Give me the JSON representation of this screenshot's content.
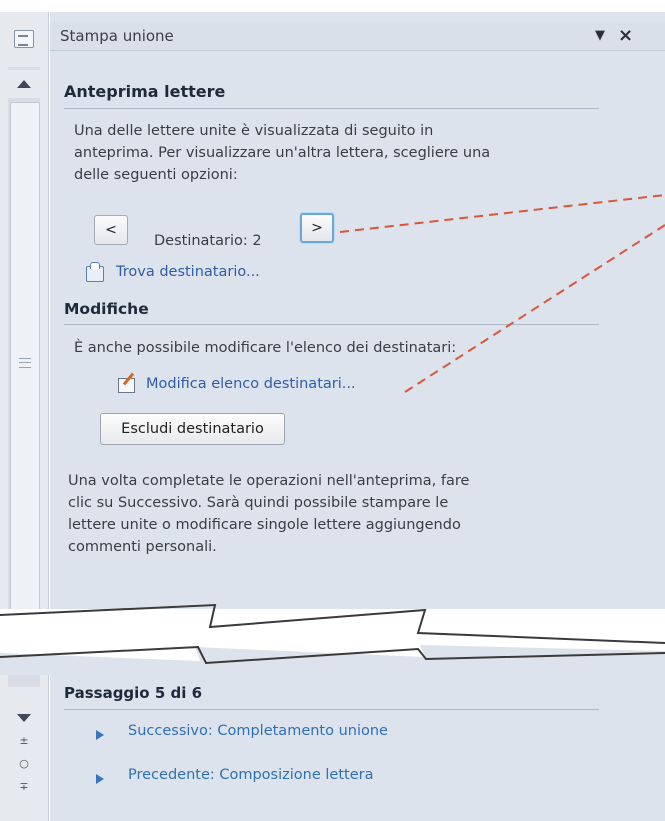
{
  "pane": {
    "title": "Stampa unione",
    "menu_icon": "dropdown-triangle",
    "close_label": "×"
  },
  "preview": {
    "heading": "Anteprima lettere",
    "line1": "Una delle lettere unite è visualizzata di seguito in",
    "line2": "anteprima. Per visualizzare un'altra lettera, scegliere una",
    "line3": "delle seguenti opzioni:",
    "prev_label": "<",
    "next_label": ">",
    "recipient_text": "Destinatario: 2",
    "find_link": "Trova destinatario..."
  },
  "changes": {
    "heading": "Modifiche",
    "intro": "È anche possibile modificare l'elenco dei destinatari:",
    "edit_link": "Modifica elenco destinatari...",
    "exclude_button": "Escludi destinatario",
    "outro1": "Una volta completate le operazioni nell'anteprima, fare",
    "outro2": "clic su Successivo. Sarà quindi possibile stampare le",
    "outro3": "lettere unite o modificare singole lettere aggiungendo",
    "outro4": "commenti personali."
  },
  "step": {
    "title": "Passaggio 5 di 6",
    "next_link": "Successivo: Completamento unione",
    "prev_link": "Precedente: Composizione lettera"
  },
  "scrollbar": {
    "bottom_icons": [
      "±",
      "○",
      "∓"
    ]
  },
  "colors": {
    "link": "#2f5da8",
    "step_link": "#2f6fb6",
    "annotation_line": "#d9563a",
    "pane_bg": "#dde3ec"
  }
}
